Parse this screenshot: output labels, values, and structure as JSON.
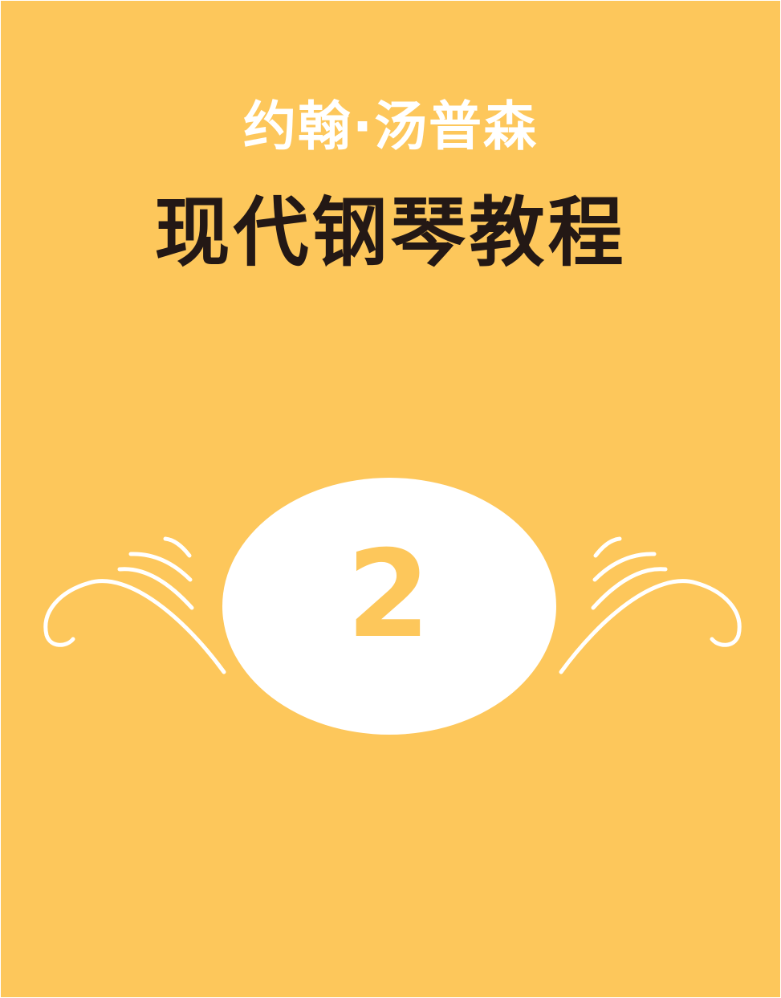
{
  "cover": {
    "author": "约翰·汤普森",
    "title": "现代钢琴教程",
    "volume": "2",
    "colors": {
      "background": "#FDC75B",
      "title_text": "#231815",
      "ornament": "#FFFFFF"
    }
  }
}
